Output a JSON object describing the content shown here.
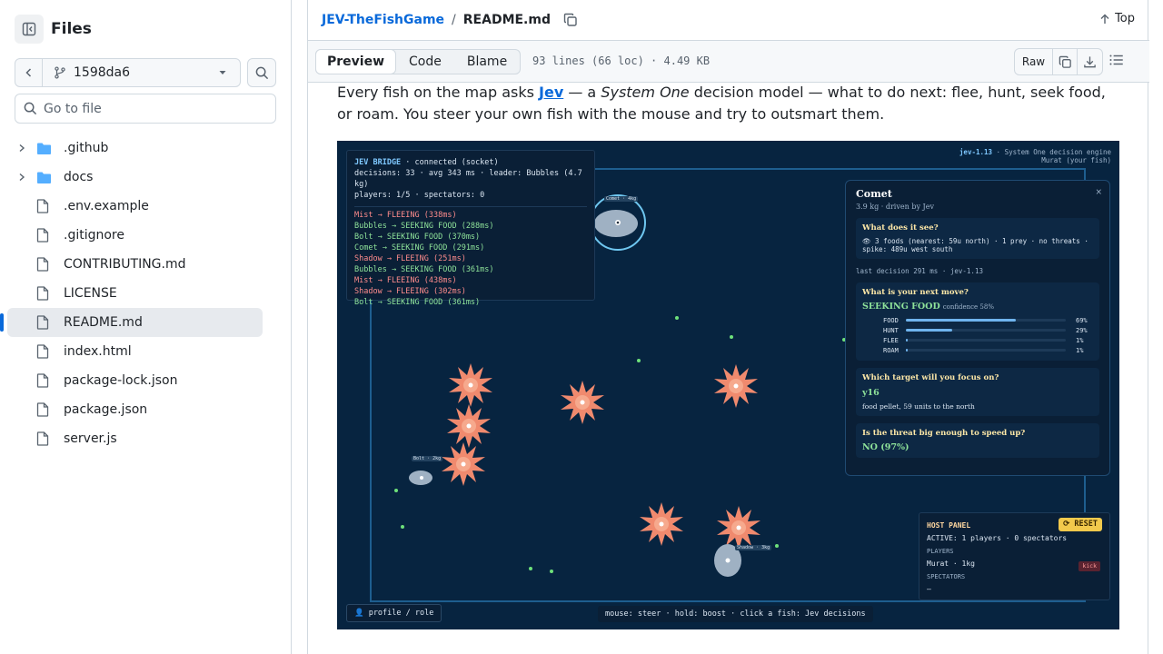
{
  "sidebar": {
    "title": "Files",
    "branch": "1598da6",
    "goto_placeholder": "Go to file",
    "items": [
      {
        "label": ".github",
        "type": "folder"
      },
      {
        "label": "docs",
        "type": "folder"
      },
      {
        "label": ".env.example",
        "type": "file"
      },
      {
        "label": ".gitignore",
        "type": "file"
      },
      {
        "label": "CONTRIBUTING.md",
        "type": "file"
      },
      {
        "label": "LICENSE",
        "type": "file"
      },
      {
        "label": "README.md",
        "type": "file",
        "selected": true
      },
      {
        "label": "index.html",
        "type": "file"
      },
      {
        "label": "package-lock.json",
        "type": "file"
      },
      {
        "label": "package.json",
        "type": "file"
      },
      {
        "label": "server.js",
        "type": "file"
      }
    ]
  },
  "breadcrumb": {
    "repo": "JEV-TheFishGame",
    "sep": "/",
    "file": "README.md",
    "top": "Top"
  },
  "toolbar": {
    "tabs": [
      "Preview",
      "Code",
      "Blame"
    ],
    "meta": "93 lines (66 loc) · 4.49 KB",
    "raw": "Raw"
  },
  "readme": {
    "p1_a": "Every fish on the map asks ",
    "link": "Jev",
    "p1_b": " — a ",
    "em": "System One",
    "p1_c": " decision model — what to do next: flee, hunt, seek food, or roam. You steer your own fish with the mouse and try to outsmart them."
  },
  "game": {
    "bridge": {
      "title": "JEV BRIDGE",
      "status": " · connected (socket)",
      "line2": "decisions: 33 · avg 343 ms · leader: Bubbles (4.7 kg)",
      "line3": "players: 1/5 · spectators: 0",
      "log": [
        {
          "text": "Mist → FLEEING (338ms)",
          "kind": "flee"
        },
        {
          "text": "Bubbles → SEEKING FOOD (288ms)",
          "kind": "seek"
        },
        {
          "text": "Bolt → SEEKING FOOD (370ms)",
          "kind": "seek"
        },
        {
          "text": "Comet → SEEKING FOOD (291ms)",
          "kind": "seek"
        },
        {
          "text": "Shadow → FLEEING (251ms)",
          "kind": "flee"
        },
        {
          "text": "Bubbles → SEEKING FOOD (361ms)",
          "kind": "seek"
        },
        {
          "text": "Mist → FLEEING (438ms)",
          "kind": "flee"
        },
        {
          "text": "Shadow → FLEEING (302ms)",
          "kind": "flee"
        },
        {
          "text": "Bolt → SEEKING FOOD (361ms)",
          "kind": "seek"
        }
      ]
    },
    "version_a": "jev-1.13",
    "version_b": " · System One decision engine",
    "version_c": "Murat (your fish)",
    "comet": {
      "name": "Comet",
      "sub": "3.9 kg · driven by Jev",
      "close": "×",
      "q1": "What does it see?",
      "see": "👁 3 foods (nearest: 59u north) · 1 prey · no threats · spike: 489u west south",
      "last": "last decision 291 ms · jev-1.13",
      "q2": "What is your next move?",
      "move": "SEEKING FOOD",
      "confidence": "confidence 58%",
      "bars": [
        {
          "label": "FOOD",
          "pct": "69%",
          "value": 0.69
        },
        {
          "label": "HUNT",
          "pct": "29%",
          "value": 0.29
        },
        {
          "label": "FLEE",
          "pct": "1%",
          "value": 0.01
        },
        {
          "label": "ROAM",
          "pct": "1%",
          "value": 0.01
        }
      ],
      "q3": "Which target will you focus on?",
      "target": "y16",
      "target_desc": "food pellet, 59 units to the north",
      "q4": "Is the threat big enough to speed up?",
      "answer": "NO (97%)"
    },
    "host": {
      "title": "HOST PANEL",
      "reset": "⟳ RESET",
      "active": "ACTIVE: 1 players · 0 spectators",
      "players_label": "PLAYERS",
      "player": "Murat · 1kg",
      "kick": "kick",
      "spectators_label": "SPECTATORS",
      "spectators": "–"
    },
    "profile": "👤 profile / role",
    "hint": "mouse: steer · hold: boost · click a fish: Jev decisions",
    "fish_tags": [
      "Comet · 4kg",
      "Bolt · 2kg",
      "Shadow · 3kg"
    ]
  },
  "colors": {
    "link": "#0969da",
    "accent": "#0969da",
    "spike": "#f08a6e"
  }
}
